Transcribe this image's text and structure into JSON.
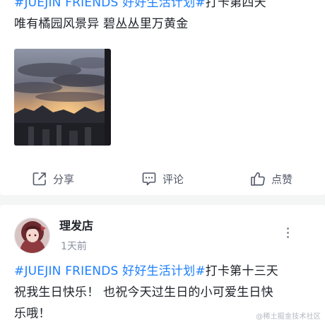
{
  "post1": {
    "line1_topic": "#JUEJIN FRIENDS  好好生活计划#",
    "line1_text": "打卡第四天",
    "line2_text": "唯有橘园风景异 碧丛丛里万黄金",
    "photo_icon": "sunset-photo"
  },
  "actions": {
    "share_label": "分享",
    "comment_label": "评论",
    "like_label": "点赞",
    "share_icon": "share-icon",
    "comment_icon": "comment-icon",
    "like_icon": "thumbs-up-icon"
  },
  "post2": {
    "author_name": "理发店",
    "time_text": "1天前",
    "line1_topic": "#JUEJIN FRIENDS  好好生活计划#",
    "line1_text": "打卡第十三天",
    "line2_text": "祝我生日快乐！ 也祝今天过生日的小可爱生日快",
    "line3_text": "乐哦！",
    "more_icon": "more-vertical-icon"
  },
  "watermark": "@稀土掘金技术社区"
}
